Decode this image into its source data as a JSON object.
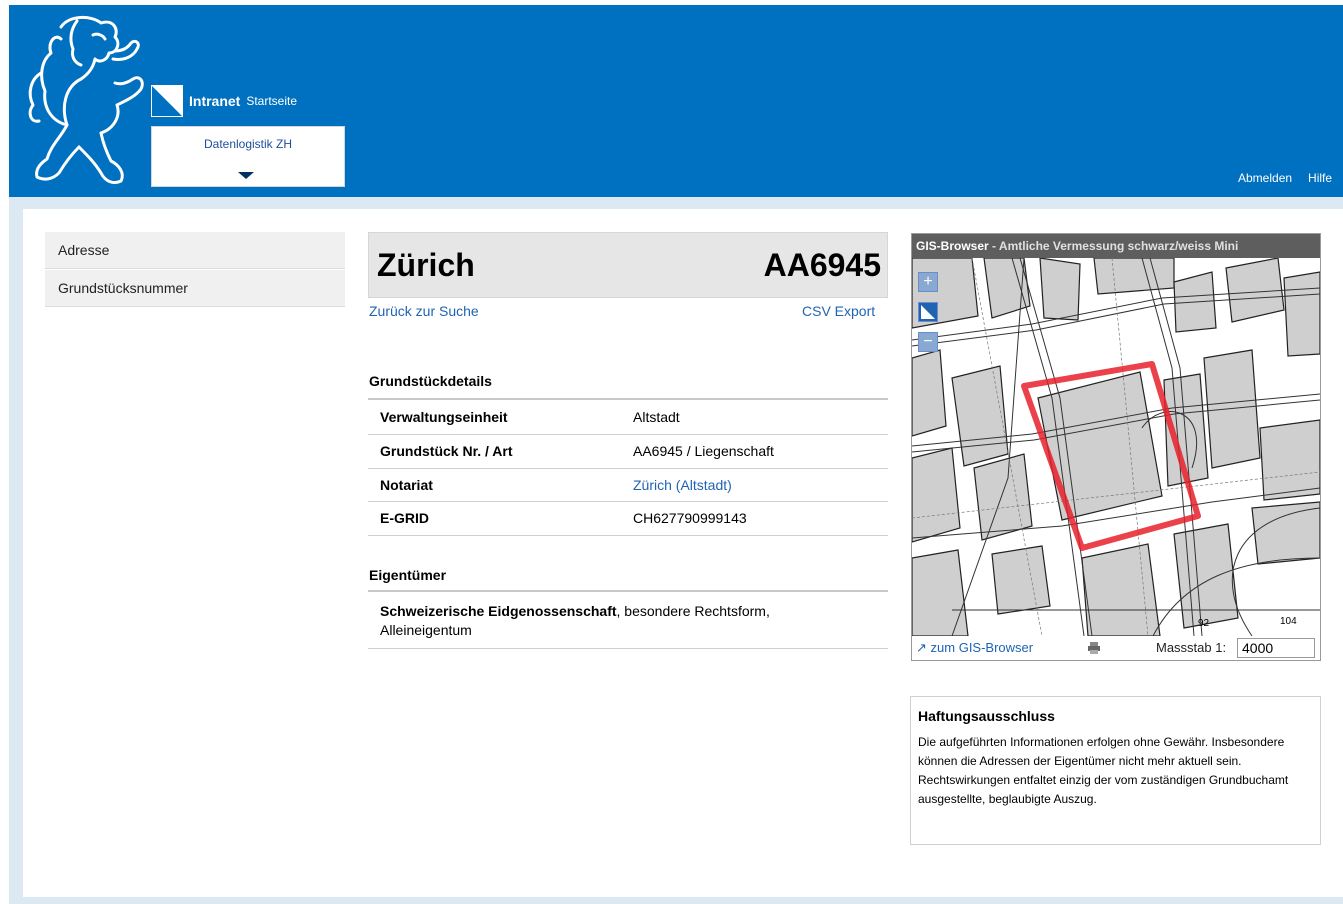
{
  "header": {
    "brand_name": "Intranet",
    "brand_sub": "Startseite",
    "dropdown_label": "Datenlogistik ZH",
    "logout": "Abmelden",
    "help": "Hilfe",
    "color": "#0070c0"
  },
  "sidebar": {
    "items": [
      {
        "label": "Adresse"
      },
      {
        "label": "Grundstücksnummer"
      }
    ]
  },
  "main": {
    "title_city": "Zürich",
    "title_number": "AA6945",
    "back_link": "Zurück zur Suche",
    "csv_link": "CSV Export",
    "details_heading": "Grundstückdetails",
    "details": [
      {
        "label": "Verwaltungseinheit",
        "value": "Altstadt"
      },
      {
        "label": "Grundstück Nr. / Art",
        "value": "AA6945 / Liegenschaft"
      },
      {
        "label": "Notariat",
        "value": "Zürich (Altstadt)"
      },
      {
        "label": "E-GRID",
        "value": "CH627790999143"
      }
    ],
    "owner_heading": "Eigentümer",
    "owner_name": "Schweizerische Eidgenossenschaft",
    "owner_rest": ", besondere Rechtsform,",
    "owner_line2": "Alleineigentum"
  },
  "gis": {
    "title": "GIS-Browser",
    "subtitle": " - Amtliche Vermessung schwarz/weiss Mini",
    "zoom_in": "+",
    "zoom_out": "−",
    "to_gis_label": "zum GIS-Browser",
    "scale_label": "Massstab 1:",
    "scale_value": "4000",
    "map_labels": {
      "a": "92",
      "b": "104"
    },
    "highlight_color": "#e8202a"
  },
  "disclaimer": {
    "heading": "Haftungsausschluss",
    "text": "Die aufgeführten Informationen erfolgen ohne Gewähr. Insbesondere können die Adressen der Eigentümer nicht mehr aktuell sein. Rechtswirkungen entfaltet einzig der vom zuständigen Grundbuchamt ausgestellte, beglaubigte Auszug."
  }
}
